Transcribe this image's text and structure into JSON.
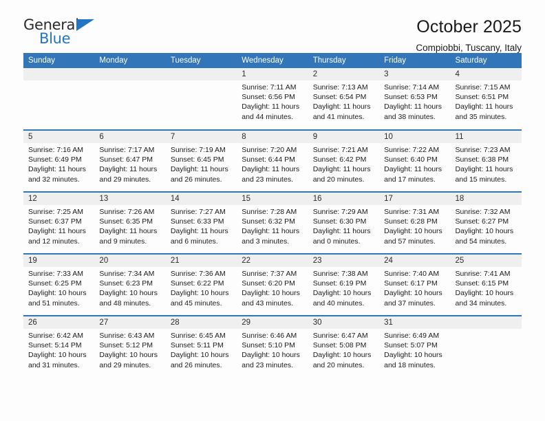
{
  "brand": {
    "name_top": "General",
    "name_bottom": "Blue",
    "accent_color": "#2175c4"
  },
  "header": {
    "title": "October 2025",
    "subtitle": "Compiobbi, Tuscany, Italy"
  },
  "theme": {
    "header_row_bg": "#3275b8",
    "day_number_bg": "#efefef",
    "page_bg": "#fdfdfd",
    "text_color": "#1a1a1a"
  },
  "calendar": {
    "weekday_headers": [
      "Sunday",
      "Monday",
      "Tuesday",
      "Wednesday",
      "Thursday",
      "Friday",
      "Saturday"
    ],
    "labels": {
      "sunrise": "Sunrise:",
      "sunset": "Sunset:",
      "daylight": "Daylight:"
    },
    "weeks": [
      [
        {
          "day": "",
          "sunrise": "",
          "sunset": "",
          "daylight": ""
        },
        {
          "day": "",
          "sunrise": "",
          "sunset": "",
          "daylight": ""
        },
        {
          "day": "",
          "sunrise": "",
          "sunset": "",
          "daylight": ""
        },
        {
          "day": "1",
          "sunrise": "Sunrise: 7:11 AM",
          "sunset": "Sunset: 6:56 PM",
          "daylight": "Daylight: 11 hours and 44 minutes."
        },
        {
          "day": "2",
          "sunrise": "Sunrise: 7:13 AM",
          "sunset": "Sunset: 6:54 PM",
          "daylight": "Daylight: 11 hours and 41 minutes."
        },
        {
          "day": "3",
          "sunrise": "Sunrise: 7:14 AM",
          "sunset": "Sunset: 6:53 PM",
          "daylight": "Daylight: 11 hours and 38 minutes."
        },
        {
          "day": "4",
          "sunrise": "Sunrise: 7:15 AM",
          "sunset": "Sunset: 6:51 PM",
          "daylight": "Daylight: 11 hours and 35 minutes."
        }
      ],
      [
        {
          "day": "5",
          "sunrise": "Sunrise: 7:16 AM",
          "sunset": "Sunset: 6:49 PM",
          "daylight": "Daylight: 11 hours and 32 minutes."
        },
        {
          "day": "6",
          "sunrise": "Sunrise: 7:17 AM",
          "sunset": "Sunset: 6:47 PM",
          "daylight": "Daylight: 11 hours and 29 minutes."
        },
        {
          "day": "7",
          "sunrise": "Sunrise: 7:19 AM",
          "sunset": "Sunset: 6:45 PM",
          "daylight": "Daylight: 11 hours and 26 minutes."
        },
        {
          "day": "8",
          "sunrise": "Sunrise: 7:20 AM",
          "sunset": "Sunset: 6:44 PM",
          "daylight": "Daylight: 11 hours and 23 minutes."
        },
        {
          "day": "9",
          "sunrise": "Sunrise: 7:21 AM",
          "sunset": "Sunset: 6:42 PM",
          "daylight": "Daylight: 11 hours and 20 minutes."
        },
        {
          "day": "10",
          "sunrise": "Sunrise: 7:22 AM",
          "sunset": "Sunset: 6:40 PM",
          "daylight": "Daylight: 11 hours and 17 minutes."
        },
        {
          "day": "11",
          "sunrise": "Sunrise: 7:23 AM",
          "sunset": "Sunset: 6:38 PM",
          "daylight": "Daylight: 11 hours and 15 minutes."
        }
      ],
      [
        {
          "day": "12",
          "sunrise": "Sunrise: 7:25 AM",
          "sunset": "Sunset: 6:37 PM",
          "daylight": "Daylight: 11 hours and 12 minutes."
        },
        {
          "day": "13",
          "sunrise": "Sunrise: 7:26 AM",
          "sunset": "Sunset: 6:35 PM",
          "daylight": "Daylight: 11 hours and 9 minutes."
        },
        {
          "day": "14",
          "sunrise": "Sunrise: 7:27 AM",
          "sunset": "Sunset: 6:33 PM",
          "daylight": "Daylight: 11 hours and 6 minutes."
        },
        {
          "day": "15",
          "sunrise": "Sunrise: 7:28 AM",
          "sunset": "Sunset: 6:32 PM",
          "daylight": "Daylight: 11 hours and 3 minutes."
        },
        {
          "day": "16",
          "sunrise": "Sunrise: 7:29 AM",
          "sunset": "Sunset: 6:30 PM",
          "daylight": "Daylight: 11 hours and 0 minutes."
        },
        {
          "day": "17",
          "sunrise": "Sunrise: 7:31 AM",
          "sunset": "Sunset: 6:28 PM",
          "daylight": "Daylight: 10 hours and 57 minutes."
        },
        {
          "day": "18",
          "sunrise": "Sunrise: 7:32 AM",
          "sunset": "Sunset: 6:27 PM",
          "daylight": "Daylight: 10 hours and 54 minutes."
        }
      ],
      [
        {
          "day": "19",
          "sunrise": "Sunrise: 7:33 AM",
          "sunset": "Sunset: 6:25 PM",
          "daylight": "Daylight: 10 hours and 51 minutes."
        },
        {
          "day": "20",
          "sunrise": "Sunrise: 7:34 AM",
          "sunset": "Sunset: 6:23 PM",
          "daylight": "Daylight: 10 hours and 48 minutes."
        },
        {
          "day": "21",
          "sunrise": "Sunrise: 7:36 AM",
          "sunset": "Sunset: 6:22 PM",
          "daylight": "Daylight: 10 hours and 45 minutes."
        },
        {
          "day": "22",
          "sunrise": "Sunrise: 7:37 AM",
          "sunset": "Sunset: 6:20 PM",
          "daylight": "Daylight: 10 hours and 43 minutes."
        },
        {
          "day": "23",
          "sunrise": "Sunrise: 7:38 AM",
          "sunset": "Sunset: 6:19 PM",
          "daylight": "Daylight: 10 hours and 40 minutes."
        },
        {
          "day": "24",
          "sunrise": "Sunrise: 7:40 AM",
          "sunset": "Sunset: 6:17 PM",
          "daylight": "Daylight: 10 hours and 37 minutes."
        },
        {
          "day": "25",
          "sunrise": "Sunrise: 7:41 AM",
          "sunset": "Sunset: 6:15 PM",
          "daylight": "Daylight: 10 hours and 34 minutes."
        }
      ],
      [
        {
          "day": "26",
          "sunrise": "Sunrise: 6:42 AM",
          "sunset": "Sunset: 5:14 PM",
          "daylight": "Daylight: 10 hours and 31 minutes."
        },
        {
          "day": "27",
          "sunrise": "Sunrise: 6:43 AM",
          "sunset": "Sunset: 5:12 PM",
          "daylight": "Daylight: 10 hours and 29 minutes."
        },
        {
          "day": "28",
          "sunrise": "Sunrise: 6:45 AM",
          "sunset": "Sunset: 5:11 PM",
          "daylight": "Daylight: 10 hours and 26 minutes."
        },
        {
          "day": "29",
          "sunrise": "Sunrise: 6:46 AM",
          "sunset": "Sunset: 5:10 PM",
          "daylight": "Daylight: 10 hours and 23 minutes."
        },
        {
          "day": "30",
          "sunrise": "Sunrise: 6:47 AM",
          "sunset": "Sunset: 5:08 PM",
          "daylight": "Daylight: 10 hours and 20 minutes."
        },
        {
          "day": "31",
          "sunrise": "Sunrise: 6:49 AM",
          "sunset": "Sunset: 5:07 PM",
          "daylight": "Daylight: 10 hours and 18 minutes."
        },
        {
          "day": "",
          "sunrise": "",
          "sunset": "",
          "daylight": ""
        }
      ]
    ]
  }
}
